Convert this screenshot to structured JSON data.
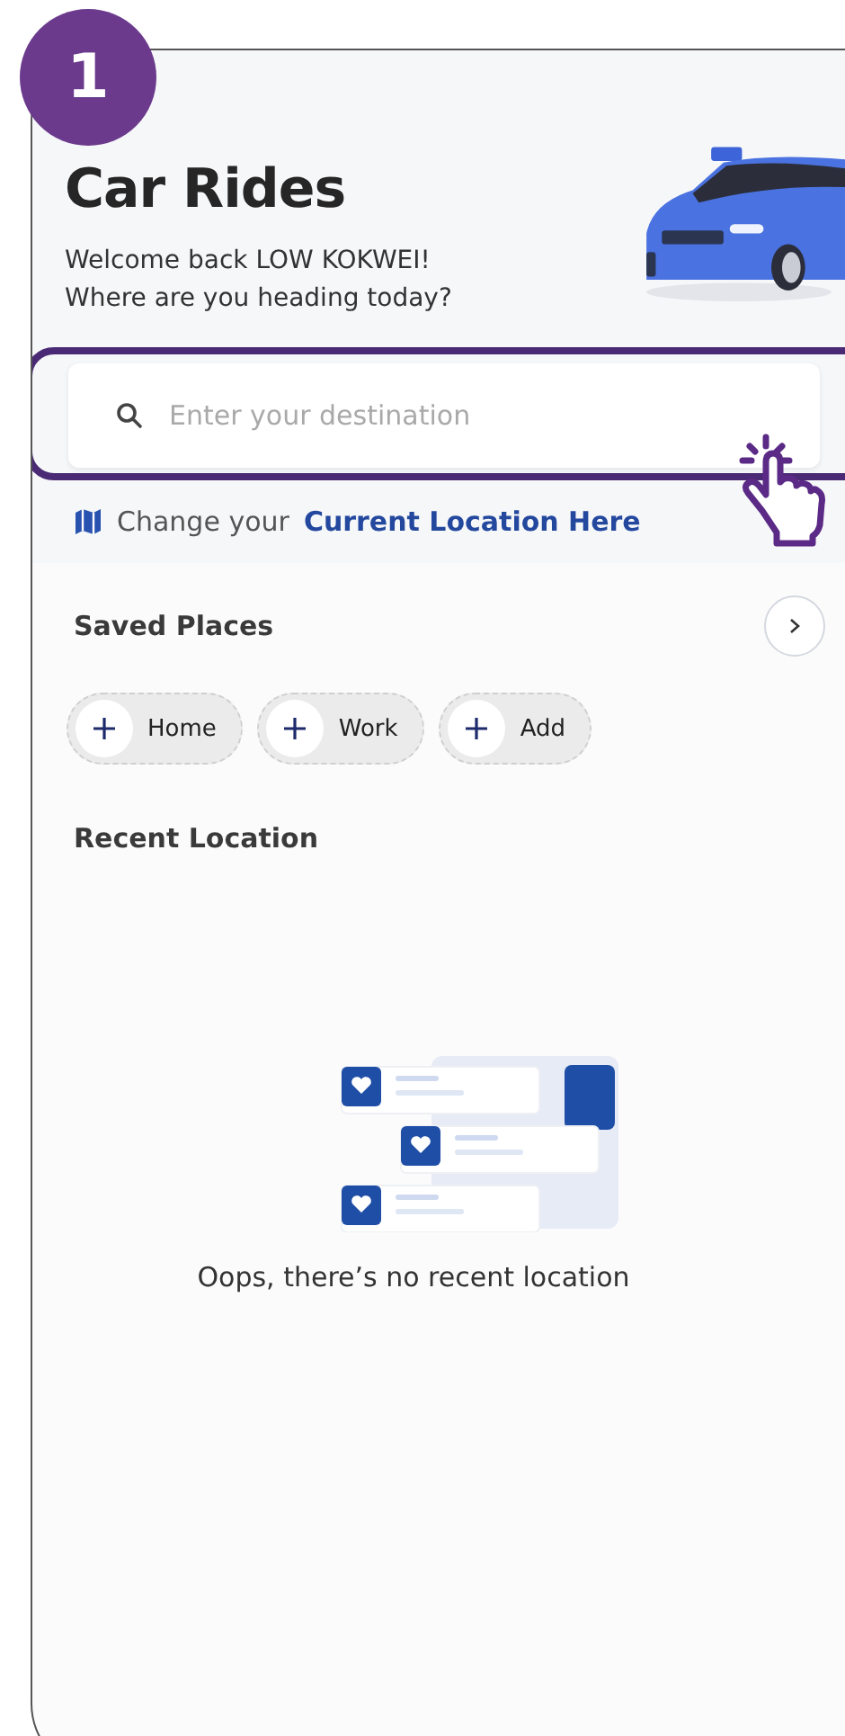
{
  "step_badge": "1",
  "header": {
    "title": "Car Rides",
    "greeting_lines": [
      "Welcome back LOW KOKWEI!",
      "Where are you heading today?"
    ]
  },
  "search": {
    "placeholder": "Enter your destination"
  },
  "location": {
    "prefix": "Change your",
    "link": "Current Location Here"
  },
  "saved_places": {
    "title": "Saved Places",
    "chips": [
      {
        "label": "Home"
      },
      {
        "label": "Work"
      },
      {
        "label": "Add"
      }
    ]
  },
  "recent_location": {
    "title": "Recent Location",
    "empty_message": "Oops, there’s no recent location"
  }
}
